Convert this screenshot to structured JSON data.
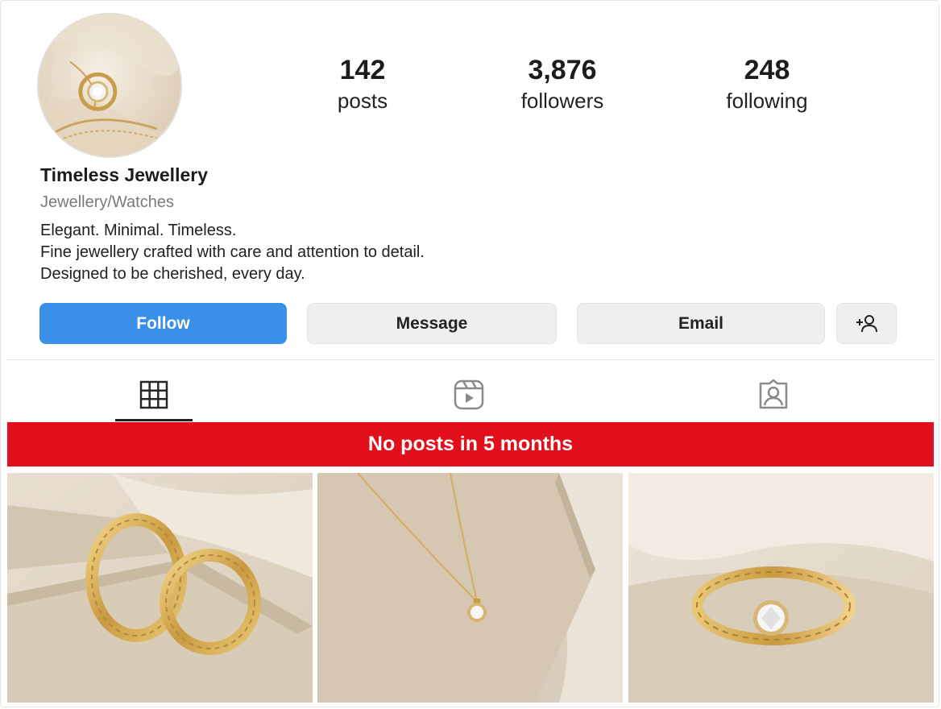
{
  "profile": {
    "username": "Timeless Jewellery",
    "category": "Jewellery/Watches",
    "bio": [
      "Elegant. Minimal. Timeless.",
      "Fine jewellery crafted with care and attention to detail.",
      "Designed to be cherished, every day."
    ],
    "avatar_icon": "gold-pendant-photo"
  },
  "stats": {
    "posts": {
      "value": "142",
      "label": "posts"
    },
    "followers": {
      "value": "3,876",
      "label": "followers"
    },
    "following": {
      "value": "248",
      "label": "following"
    }
  },
  "actions": {
    "follow": "Follow",
    "message": "Message",
    "email": "Email",
    "add_user_icon": "person-plus-icon"
  },
  "tabs": [
    {
      "icon": "grid-icon",
      "active": true
    },
    {
      "icon": "reels-icon",
      "active": false
    },
    {
      "icon": "tagged-icon",
      "active": false
    }
  ],
  "banner": {
    "text": "No posts in 5 months",
    "color": "#e20e1b"
  },
  "posts": [
    {
      "subject": "gold-hoop-earrings"
    },
    {
      "subject": "gold-pendant-necklace"
    },
    {
      "subject": "gold-solitaire-ring"
    }
  ],
  "colors": {
    "accent": "#3a8fe8",
    "button_secondary": "#efefef",
    "banner": "#e20e1b"
  }
}
